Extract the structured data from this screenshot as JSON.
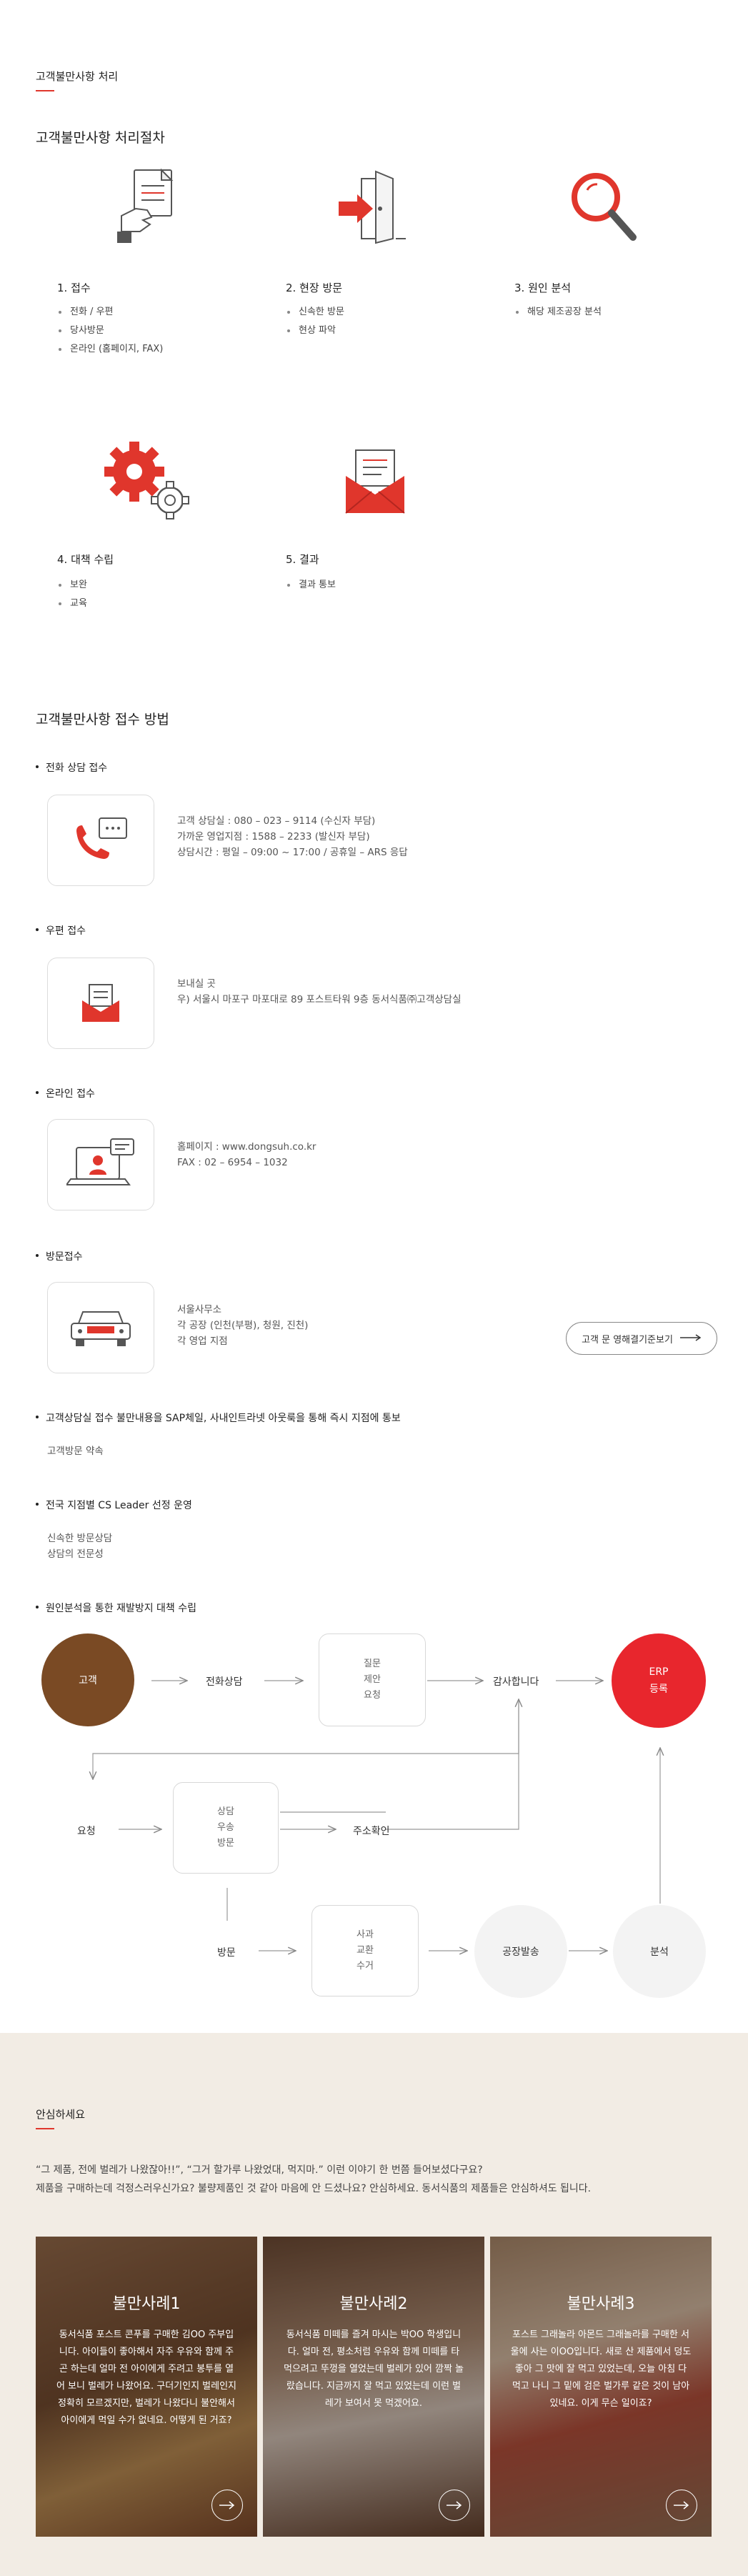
{
  "page_title": "고객불만사항 처리",
  "procedure": {
    "heading": "고객불만사항 처리절차",
    "steps": [
      {
        "title": "1. 접수",
        "items": [
          "전화 / 우편",
          "당사방문",
          "온라인 (홈페이지, FAX)"
        ],
        "icon": "document-hand-icon"
      },
      {
        "title": "2. 현장 방문",
        "items": [
          "신속한 방문",
          "현상 파악"
        ],
        "icon": "door-enter-icon"
      },
      {
        "title": "3. 원인 분석",
        "items": [
          "해당 제조공장 분석"
        ],
        "icon": "magnifier-icon"
      },
      {
        "title": "4. 대책 수립",
        "items": [
          "보완",
          "교육"
        ],
        "icon": "gears-icon"
      },
      {
        "title": "5. 결과",
        "items": [
          "결과 통보"
        ],
        "icon": "mail-envelope-icon"
      }
    ]
  },
  "methods": {
    "heading": "고객불만사항 접수 방법",
    "phone": {
      "title": "전화 상담 접수",
      "lines": [
        "고객 상담실 : 080 – 023 – 9114 (수신자 부담)",
        "가까운 영업지점 : 1588 – 2233 (발신자 부담)",
        "상담시간 : 평일 – 09:00 ~ 17:00 / 공휴일 – ARS 응답"
      ]
    },
    "post": {
      "title": "우편 접수",
      "lines": [
        "보내실 곳",
        "우) 서울시 마포구 마포대로 89 포스트타워 9층 동서식품㈜고객상담실"
      ]
    },
    "online": {
      "title": "온라인 접수",
      "lines": [
        "홈페이지 : www.dongsuh.co.kr",
        "FAX : 02 – 6954 – 1032"
      ]
    },
    "visit": {
      "title": "방문접수",
      "lines": [
        "서울사무소",
        "각 공장 (인천(부평), 청원, 진천)",
        "각 영업 지점"
      ],
      "button": "고객 문 영해결기준보기"
    },
    "sap": {
      "title": "고객상담실 접수 불만내용을 SAP체일, 사내인트라넷 아웃룩을 통해 즉시 지점에 통보",
      "lines": [
        "고객방문 약속"
      ]
    },
    "cs": {
      "title": "전국 지점별 CS Leader 선정 운영",
      "lines": [
        "신속한 방문상담",
        "상담의 전문성"
      ]
    },
    "flow": {
      "title": "원인분석을 통한 재발방지 대책 수립"
    }
  },
  "flow": {
    "customer": "고객",
    "phone_consult": "전화상담",
    "box1": [
      "질문",
      "제안",
      "요청"
    ],
    "thanks": "감사합니다",
    "erp": [
      "ERP",
      "등록"
    ],
    "request": "요청",
    "box2": [
      "상담",
      "우송",
      "방문"
    ],
    "confirm": "주소확인",
    "visit": "방문",
    "box3": [
      "사과",
      "교환",
      "수거"
    ],
    "factory": "공장발송",
    "analysis": "분석",
    "colors": {
      "customer": "#7a4a24",
      "erp": "#e8262d",
      "grey": "#f3f3f3"
    }
  },
  "reassure": {
    "heading": "안심하세요",
    "intro": [
      "“그 제품, 전에 벌레가 나왔잖아!!”, “그거 할가루 나왔었대, 먹지마.” 이런 이야기 한 번쯤 들어보셨다구요?",
      "제품을 구매하는데 걱정스러우신가요? 불량제품인 것 같아 마음에 안 드셨나요? 안심하세요. 동서식품의 제품들은 안심하셔도 됩니다."
    ],
    "cards": [
      {
        "title": "불만사례1",
        "text": "동서식품 포스트 콘푸를 구매한 김OO 주부입니다. 아이들이 좋아해서 자주 우유와 함께 주곤 하는데 얼마 전 아이에게 주려고 봉투를 열어 보니 벌레가 나왔어요. 구더기인지 벌레인지 정확히 모르겠지만, 벌레가 나왔다니 불안해서 아이에게 먹일 수가 없네요. 어떻게 된 거죠?"
      },
      {
        "title": "불만사례2",
        "text": "동서식품 미떼를 즐겨 마시는 박OO 학생입니다. 얼마 전, 평소처럼 우유와 함께 미떼를 타 먹으려고 뚜껑을 열었는데 벌레가 있어 깜짝 놀랐습니다. 지금까지 잘 먹고 있었는데 이런 벌레가 보여서 못 먹겠어요."
      },
      {
        "title": "불만사례3",
        "text": "포스트 그래놀라 아몬드 그래놀라를 구매한 서울에 사는 이OO입니다. 새로 산 제품에서 덩도 좋아 그 맛에 잘 먹고 있었는데, 오늘 아침 다 먹고 나니 그 밑에 검은 벌가루 같은 것이 남아 있네요. 이게 무슨 일이죠?"
      }
    ]
  }
}
